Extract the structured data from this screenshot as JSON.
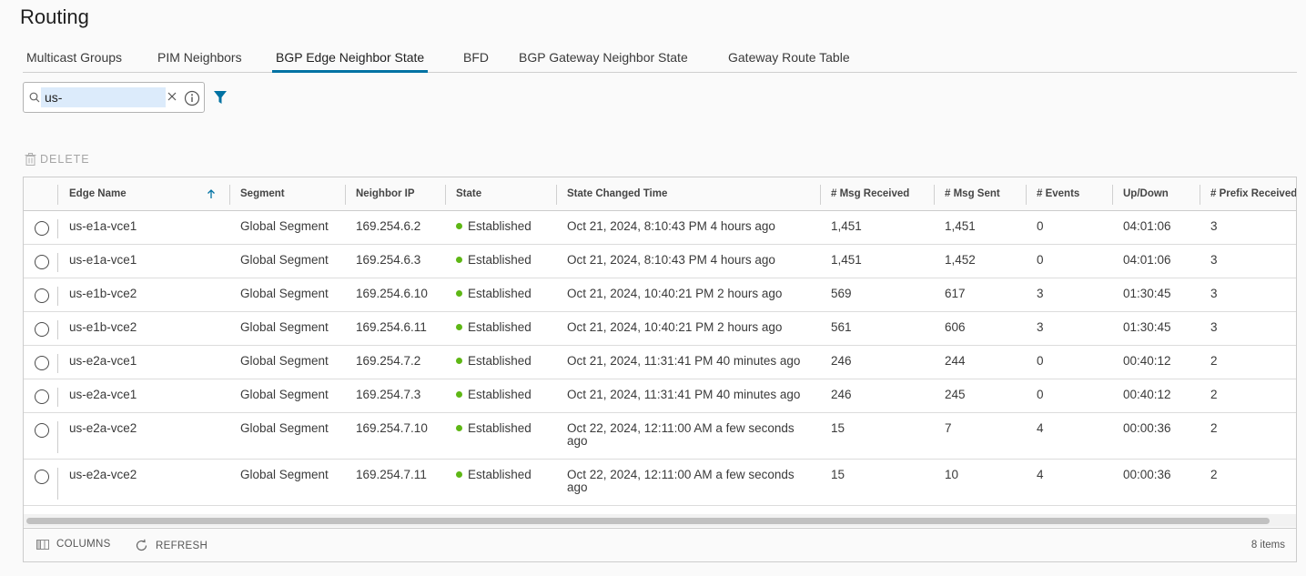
{
  "page_title": "Routing",
  "tabs": [
    {
      "label": "Multicast Groups",
      "active": false
    },
    {
      "label": "PIM Neighbors",
      "active": false
    },
    {
      "label": "BGP Edge Neighbor State",
      "active": true
    },
    {
      "label": "BFD",
      "active": false
    },
    {
      "label": "BGP Gateway Neighbor State",
      "active": false
    },
    {
      "label": "Gateway Route Table",
      "active": false
    }
  ],
  "search": {
    "value": "us-"
  },
  "toolbar": {
    "delete_label": "DELETE"
  },
  "table": {
    "columns": [
      "Edge Name",
      "Segment",
      "Neighbor IP",
      "State",
      "State Changed Time",
      "# Msg Received",
      "# Msg Sent",
      "# Events",
      "Up/Down",
      "# Prefix Received"
    ],
    "sort_column": "Edge Name",
    "sort_direction": "ascending",
    "rows": [
      {
        "edge": "us-e1a-vce1",
        "segment": "Global Segment",
        "ip": "169.254.6.2",
        "state": "Established",
        "changed": "Oct 21, 2024, 8:10:43 PM 4 hours ago",
        "recv": "1,451",
        "sent": "1,451",
        "events": "0",
        "updown": "04:01:06",
        "prefix": "3"
      },
      {
        "edge": "us-e1a-vce1",
        "segment": "Global Segment",
        "ip": "169.254.6.3",
        "state": "Established",
        "changed": "Oct 21, 2024, 8:10:43 PM 4 hours ago",
        "recv": "1,451",
        "sent": "1,452",
        "events": "0",
        "updown": "04:01:06",
        "prefix": "3"
      },
      {
        "edge": "us-e1b-vce2",
        "segment": "Global Segment",
        "ip": "169.254.6.10",
        "state": "Established",
        "changed": "Oct 21, 2024, 10:40:21 PM 2 hours ago",
        "recv": "569",
        "sent": "617",
        "events": "3",
        "updown": "01:30:45",
        "prefix": "3"
      },
      {
        "edge": "us-e1b-vce2",
        "segment": "Global Segment",
        "ip": "169.254.6.11",
        "state": "Established",
        "changed": "Oct 21, 2024, 10:40:21 PM 2 hours ago",
        "recv": "561",
        "sent": "606",
        "events": "3",
        "updown": "01:30:45",
        "prefix": "3"
      },
      {
        "edge": "us-e2a-vce1",
        "segment": "Global Segment",
        "ip": "169.254.7.2",
        "state": "Established",
        "changed": "Oct 21, 2024, 11:31:41 PM 40 minutes ago",
        "recv": "246",
        "sent": "244",
        "events": "0",
        "updown": "00:40:12",
        "prefix": "2"
      },
      {
        "edge": "us-e2a-vce1",
        "segment": "Global Segment",
        "ip": "169.254.7.3",
        "state": "Established",
        "changed": "Oct 21, 2024, 11:31:41 PM 40 minutes ago",
        "recv": "246",
        "sent": "245",
        "events": "0",
        "updown": "00:40:12",
        "prefix": "2"
      },
      {
        "edge": "us-e2a-vce2",
        "segment": "Global Segment",
        "ip": "169.254.7.10",
        "state": "Established",
        "changed": "Oct 22, 2024, 12:11:00 AM a few seconds ago",
        "recv": "15",
        "sent": "7",
        "events": "4",
        "updown": "00:00:36",
        "prefix": "2"
      },
      {
        "edge": "us-e2a-vce2",
        "segment": "Global Segment",
        "ip": "169.254.7.11",
        "state": "Established",
        "changed": "Oct 22, 2024, 12:11:00 AM a few seconds ago",
        "recv": "15",
        "sent": "10",
        "events": "4",
        "updown": "00:00:36",
        "prefix": "2"
      }
    ]
  },
  "footer": {
    "columns_label": "COLUMNS",
    "refresh_label": "REFRESH",
    "item_count": "8 items"
  },
  "colors": {
    "accent": "#0072a3",
    "status_established": "#5eb715"
  }
}
